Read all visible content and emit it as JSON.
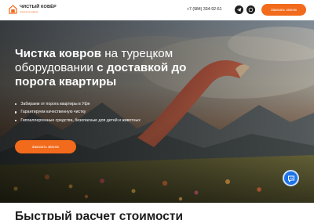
{
  "header": {
    "logo_title": "ЧИСТЫЙ КОВЁР",
    "logo_subtitle": "химчистка ковров",
    "phone": "+7 (984) 334-92-61",
    "order_button": "Заказать звонок"
  },
  "hero": {
    "title_bold_1": "Чистка ковров",
    "title_regular": " на турецком оборудовании ",
    "title_bold_2": "с доставкой до порога квартиры",
    "bullets": [
      "Забираем от порога квартиры в Уфе",
      "Гарантируем качественную чистку",
      "Гипоаллергенные средства, безопасные для детей и животных"
    ],
    "cta_button": "Заказать звонок"
  },
  "section": {
    "title": "Быстрый расчет стоимости"
  },
  "icons": {
    "logo": "house-carpet-logo",
    "telegram": "telegram-icon",
    "whatsapp": "whatsapp-icon",
    "chat": "chat-icon"
  },
  "colors": {
    "accent": "#f26a1b",
    "chat": "#1d74e8",
    "dark": "#1f1f1f"
  }
}
